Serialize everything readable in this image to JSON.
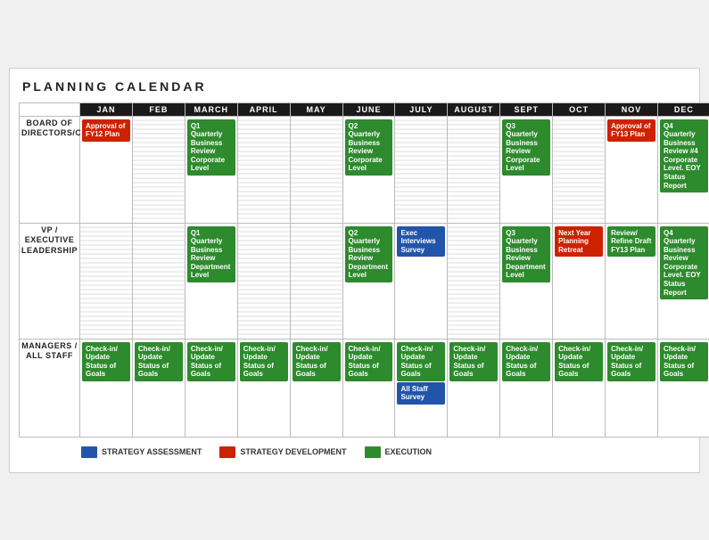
{
  "title": "PLANNING CALENDAR",
  "months": [
    "JAN",
    "FEB",
    "MARCH",
    "APRIL",
    "MAY",
    "JUNE",
    "JULY",
    "AUGUST",
    "SEPT",
    "OCT",
    "NOV",
    "DEC"
  ],
  "rows": {
    "board": {
      "label": "BOARD OF\nDIRECTORS/CEO",
      "cells": {
        "jan": {
          "type": "red",
          "text": "Approval of FY12 Plan"
        },
        "feb": {},
        "march": {
          "type": "green",
          "text": "Q1 Quarterly Business Review Corporate Level"
        },
        "april": {},
        "may": {},
        "june": {
          "type": "green",
          "text": "Q2 Quarterly Business Review Corporate Level"
        },
        "july": {},
        "august": {},
        "sept": {
          "type": "green",
          "text": "Q3 Quarterly Business Review Corporate Level"
        },
        "oct": {},
        "nov": {
          "type": "red",
          "text": "Approval of FY13 Plan"
        },
        "dec": {
          "type": "green",
          "text": "Q4 Quarterly Business Review #4 Corporate Level. EOY Status Report"
        }
      }
    },
    "vp": {
      "label": "VP / EXECUTIVE\nLEADERSHIP",
      "cells": {
        "jan": {},
        "feb": {},
        "march": {
          "type": "green",
          "text": "Q1 Quarterly Business Review Department Level"
        },
        "april": {},
        "may": {},
        "june": {
          "type": "green",
          "text": "Q2 Quarterly Business Review Department Level"
        },
        "july": {
          "type": "blue",
          "text": "Exec Interviews Survey"
        },
        "august": {},
        "sept": {
          "type": "green",
          "text": "Q3 Quarterly Business Review Department Level"
        },
        "oct": {
          "type": "red",
          "text": "Next Year Planning Retreat"
        },
        "nov": {
          "type": "green",
          "text": "Review/ Refine Draft FY13 Plan"
        },
        "dec": {
          "type": "green",
          "text": "Q4 Quarterly Business Review Corporate Level. EOY Status Report"
        }
      }
    },
    "managers": {
      "label": "MANAGERS /\nALL STAFF",
      "cells": {
        "jan": {
          "type": "green",
          "text": "Check-in/ Update Status of Goals"
        },
        "feb": {
          "type": "green",
          "text": "Check-in/ Update Status of Goals"
        },
        "march": {
          "type": "green",
          "text": "Check-in/ Update Status of Goals"
        },
        "april": {
          "type": "green",
          "text": "Check-in/ Update Status of Goals"
        },
        "may": {
          "type": "green",
          "text": "Check-in/ Update Status of Goals"
        },
        "june": {
          "type": "green",
          "text": "Check-in/ Update Status of Goals"
        },
        "july_1": {
          "type": "green",
          "text": "Check-in/ Update Status of Goals"
        },
        "july_2": {
          "type": "blue",
          "text": "All Staff Survey"
        },
        "august": {
          "type": "green",
          "text": "Check-in/ Update Status of Goals"
        },
        "sept": {
          "type": "green",
          "text": "Check-in/ Update Status of Goals"
        },
        "oct": {
          "type": "green",
          "text": "Check-in/ Update Status of Goals"
        },
        "nov": {
          "type": "green",
          "text": "Check-in/ Update Status of Goals"
        },
        "dec": {
          "type": "green",
          "text": "Check-in/ Update Status of Goals"
        }
      }
    }
  },
  "legend": [
    {
      "type": "blue",
      "label": "STRATEGY ASSESSMENT"
    },
    {
      "type": "red",
      "label": "STRATEGY DEVELOPMENT"
    },
    {
      "type": "green",
      "label": "EXECUTION"
    }
  ]
}
